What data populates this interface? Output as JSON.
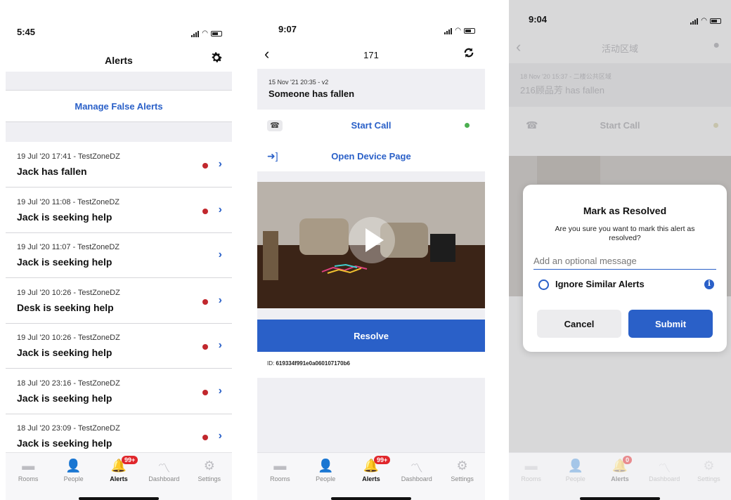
{
  "screen1": {
    "status_time": "5:45",
    "title": "Alerts",
    "manage_link": "Manage False Alerts",
    "alerts": [
      {
        "meta": "19 Jul '20 17:41 - TestZoneDZ",
        "message": "Jack has fallen",
        "unread": true
      },
      {
        "meta": "19 Jul '20 11:08 - TestZoneDZ",
        "message": "Jack is seeking help",
        "unread": true
      },
      {
        "meta": "19 Jul '20 11:07 - TestZoneDZ",
        "message": "Jack is seeking help",
        "unread": false
      },
      {
        "meta": "19 Jul '20 10:26 - TestZoneDZ",
        "message": "Desk is seeking help",
        "unread": true
      },
      {
        "meta": "19 Jul '20 10:26 - TestZoneDZ",
        "message": "Jack is seeking help",
        "unread": true
      },
      {
        "meta": "18 Jul '20 23:16 - TestZoneDZ",
        "message": "Jack is seeking help",
        "unread": true
      },
      {
        "meta": "18 Jul '20 23:09 - TestZoneDZ",
        "message": "Jack is seeking help",
        "unread": true
      }
    ],
    "tabs": [
      "Rooms",
      "People",
      "Alerts",
      "Dashboard",
      "Settings"
    ],
    "badge": "99+"
  },
  "screen2": {
    "status_time": "9:07",
    "title": "171",
    "alert_meta": "15 Nov '21 20:35 - v2",
    "alert_message": "Someone has fallen",
    "start_call": "Start Call",
    "open_device": "Open Device Page",
    "resolve": "Resolve",
    "id_label": "ID:",
    "id_value": "619334f991e0a060107170b6",
    "tabs": [
      "Rooms",
      "People",
      "Alerts",
      "Dashboard",
      "Settings"
    ],
    "badge": "99+"
  },
  "screen3": {
    "status_time": "9:04",
    "title": "活动区域",
    "alert_meta": "18 Nov '20 15:37 - 二楼公共区域",
    "alert_message": "216顾品芳 has fallen",
    "start_call": "Start Call",
    "modal": {
      "title": "Mark as Resolved",
      "body": "Are you sure you want to mark this alert as resolved?",
      "placeholder": "Add an optional message",
      "checkbox_label": "Ignore Similar Alerts",
      "cancel": "Cancel",
      "submit": "Submit"
    },
    "tabs": [
      "Rooms",
      "People",
      "Alerts",
      "Dashboard",
      "Settings"
    ],
    "badge": "0"
  },
  "colors": {
    "accent": "#2a60c8",
    "unread_dot": "#c1272d",
    "online_dot": "#4caf50",
    "badge": "#e0262b"
  },
  "icons": {
    "settings": "gear-icon",
    "back": "chevron-left-icon",
    "refresh": "refresh-icon",
    "location": "location-pin-icon",
    "call": "phone-icon",
    "device": "enter-icon",
    "info": "info-icon"
  }
}
